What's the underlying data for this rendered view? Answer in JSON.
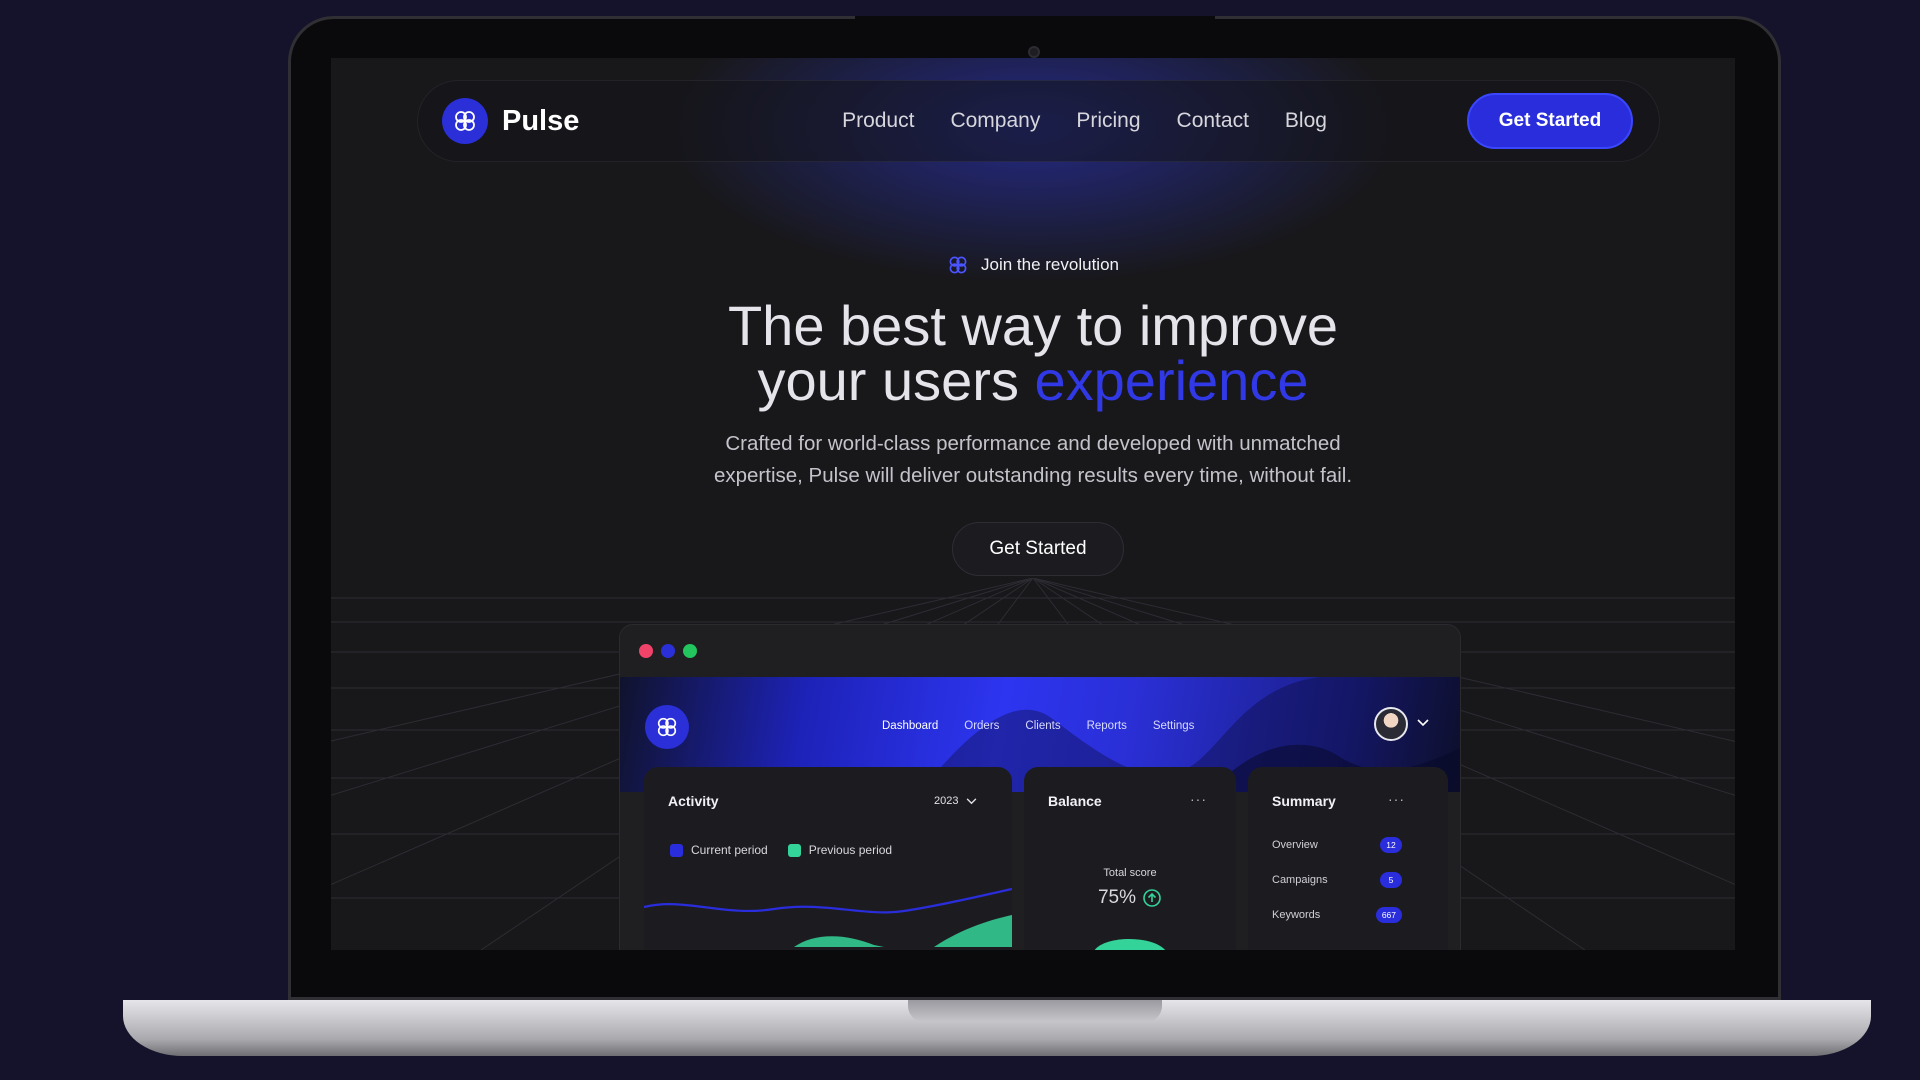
{
  "brand": {
    "name": "Pulse",
    "accent_color": "#2a2ddb"
  },
  "nav": {
    "links": [
      "Product",
      "Company",
      "Pricing",
      "Contact",
      "Blog"
    ],
    "cta_label": "Get Started"
  },
  "hero": {
    "badge": "Join the revolution",
    "title_line1": "The best way to improve",
    "title_line2_prefix": "your users ",
    "title_accent": "experience",
    "subtitle_line1": "Crafted for world-class performance and developed with unmatched",
    "subtitle_line2": "expertise, Pulse will deliver outstanding results every time, without fail.",
    "cta_label": "Get Started"
  },
  "dashboard": {
    "window_dots": [
      "#f0436a",
      "#2a2fd8",
      "#22c55e"
    ],
    "nav_items": [
      "Dashboard",
      "Orders",
      "Clients",
      "Reports",
      "Settings"
    ],
    "activity": {
      "title": "Activity",
      "year": "2023",
      "legend": [
        {
          "label": "Current period",
          "color": "#2a2ddb"
        },
        {
          "label": "Previous period",
          "color": "#34d399"
        }
      ]
    },
    "balance": {
      "title": "Balance",
      "more": "···",
      "score_label": "Total score",
      "score_value": "75%"
    },
    "summary": {
      "title": "Summary",
      "more": "···",
      "rows": [
        {
          "label": "Overview",
          "count": "12"
        },
        {
          "label": "Campaigns",
          "count": "5"
        },
        {
          "label": "Keywords",
          "count": "667"
        }
      ]
    }
  }
}
